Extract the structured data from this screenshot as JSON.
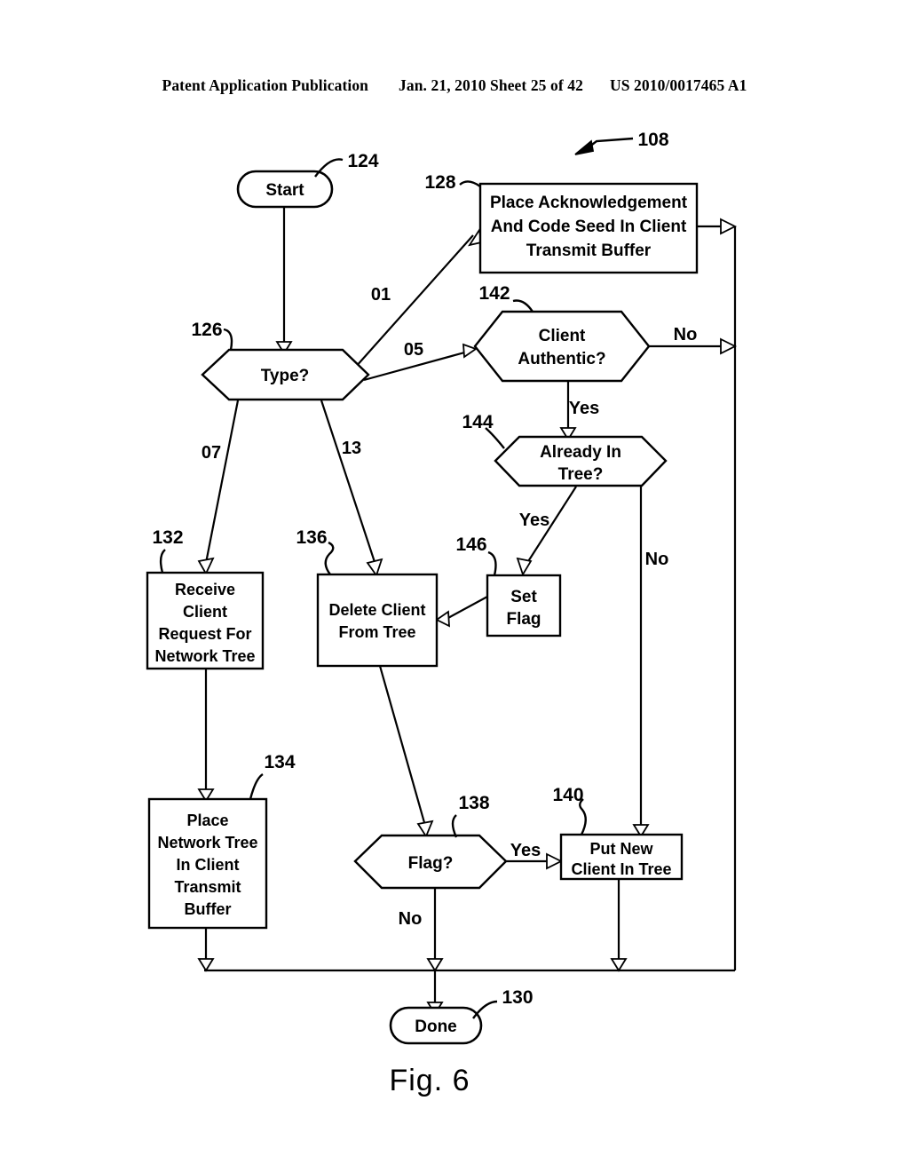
{
  "header": {
    "publication": "Patent Application Publication",
    "date_sheet": "Jan. 21, 2010  Sheet 25 of 42",
    "patent_number": "US 2010/0017465 A1"
  },
  "figure": {
    "caption": "Fig. 6",
    "diagram_ref": "108"
  },
  "nodes": {
    "start": {
      "label": "Start",
      "ref": "124"
    },
    "type_decision": {
      "label": "Type?",
      "ref": "126"
    },
    "place_ack": {
      "line1": "Place Acknowledgement",
      "line2": "And Code Seed In Client",
      "line3": "Transmit Buffer",
      "ref": "128"
    },
    "client_authentic": {
      "line1": "Client",
      "line2": "Authentic?",
      "ref": "142"
    },
    "already_in_tree": {
      "line1": "Already In",
      "line2": "Tree?",
      "ref": "144"
    },
    "set_flag": {
      "line1": "Set",
      "line2": "Flag",
      "ref": "146"
    },
    "receive_client_request": {
      "line1": "Receive",
      "line2": "Client",
      "line3": "Request For",
      "line4": "Network Tree",
      "ref": "132"
    },
    "delete_client": {
      "line1": "Delete Client",
      "line2": "From Tree",
      "ref": "136"
    },
    "place_network_tree": {
      "line1": "Place",
      "line2": "Network Tree",
      "line3": "In Client",
      "line4": "Transmit",
      "line5": "Buffer",
      "ref": "134"
    },
    "flag_decision": {
      "label": "Flag?",
      "ref": "138"
    },
    "put_new_client": {
      "line1": "Put New",
      "line2": "Client In Tree",
      "ref": "140"
    },
    "done": {
      "label": "Done",
      "ref": "130"
    }
  },
  "edge_labels": {
    "type_to_ack": "01",
    "type_to_authentic": "05",
    "type_to_receive": "07",
    "type_to_delete": "13",
    "authentic_no": "No",
    "authentic_yes": "Yes",
    "already_yes": "Yes",
    "already_no": "No",
    "flag_yes": "Yes",
    "flag_no": "No"
  },
  "colors": {
    "ink": "#000000",
    "paper": "#ffffff"
  }
}
